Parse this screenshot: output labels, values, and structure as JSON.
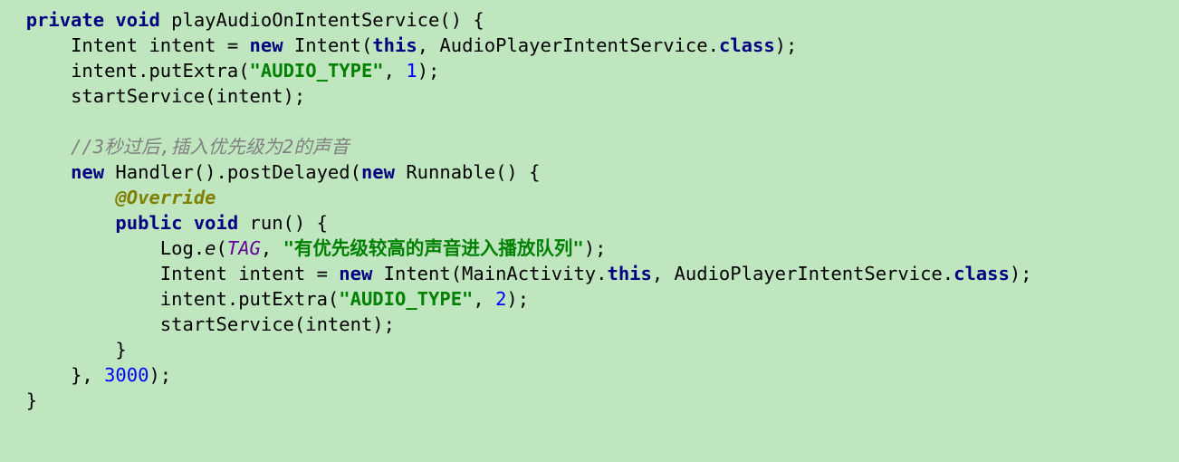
{
  "code": {
    "method_modifiers": "private void",
    "method_name": "playAudioOnIntentService",
    "intent_decl": "Intent intent = ",
    "kw_new": "new",
    "intent_ctor1": " Intent(",
    "kw_this": "this",
    "intent_ctor1_mid": ", AudioPlayerIntentService.",
    "kw_class": "class",
    "intent_ctor1_end": ");",
    "putExtra1_pre": "intent.putExtra(",
    "str_audio_type": "\"AUDIO_TYPE\"",
    "putExtra1_mid": ", ",
    "num_1": "1",
    "putExtra1_end": ");",
    "startService1": "startService(intent);",
    "comment_line": "//3秒过后,插入优先级为2的声音",
    "handler_pre": " Handler().postDelayed(",
    "runnable_pre": " Runnable() {",
    "override": "@Override",
    "run_modifiers": "public void",
    "run_name": " run() {",
    "log_pre": "Log.",
    "log_e": "e",
    "log_open": "(",
    "log_tag": "TAG",
    "log_mid": ", ",
    "str_log_msg": "\"有优先级较高的声音进入播放队列\"",
    "log_end": ");",
    "intent2_decl": "Intent intent = ",
    "intent2_ctor_pre": " Intent(MainActivity.",
    "intent2_ctor_mid": ", AudioPlayerIntentService.",
    "intent2_ctor_end": ");",
    "putExtra2_pre": "intent.putExtra(",
    "putExtra2_mid": ", ",
    "num_2": "2",
    "putExtra2_end": ");",
    "startService2": "startService(intent);",
    "inner_close": "}",
    "delayed_close_pre": "}, ",
    "num_3000": "3000",
    "delayed_close_end": ");",
    "method_close": "}"
  }
}
